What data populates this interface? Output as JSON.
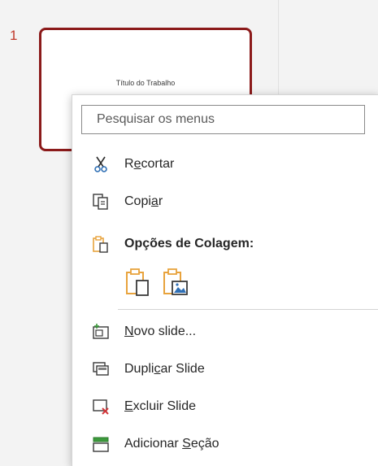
{
  "slides": {
    "items": [
      {
        "number": "1",
        "title": "Título do Trabalho"
      }
    ]
  },
  "context_menu": {
    "search": {
      "placeholder": "Pesquisar os menus",
      "value": ""
    },
    "items": [
      {
        "key": "cut",
        "pre": "R",
        "accel": "e",
        "post": "cortar",
        "icon": "scissors-icon"
      },
      {
        "key": "copy",
        "pre": "Copi",
        "accel": "a",
        "post": "r",
        "icon": "copy-icon"
      },
      {
        "key": "paste-options",
        "label": "Opções de Colagem:",
        "icon": "paste-icon"
      },
      {
        "key": "new-slide",
        "pre": "",
        "accel": "N",
        "post": "ovo slide...",
        "icon": "new-slide-icon"
      },
      {
        "key": "duplicate-slide",
        "pre": "Dupli",
        "accel": "c",
        "post": "ar Slide",
        "icon": "duplicate-slide-icon"
      },
      {
        "key": "delete-slide",
        "pre": "",
        "accel": "E",
        "post": "xcluir Slide",
        "icon": "delete-slide-icon"
      },
      {
        "key": "add-section",
        "pre": "Adicionar ",
        "accel": "S",
        "post": "eção",
        "icon": "section-icon"
      }
    ],
    "paste_buttons": [
      {
        "name": "paste-use-destination-theme-icon"
      },
      {
        "name": "paste-as-picture-icon"
      }
    ]
  },
  "colors": {
    "accent": "#c0392b",
    "selected_border": "#8b1a1a",
    "paste_icon": "#e8a33d"
  }
}
